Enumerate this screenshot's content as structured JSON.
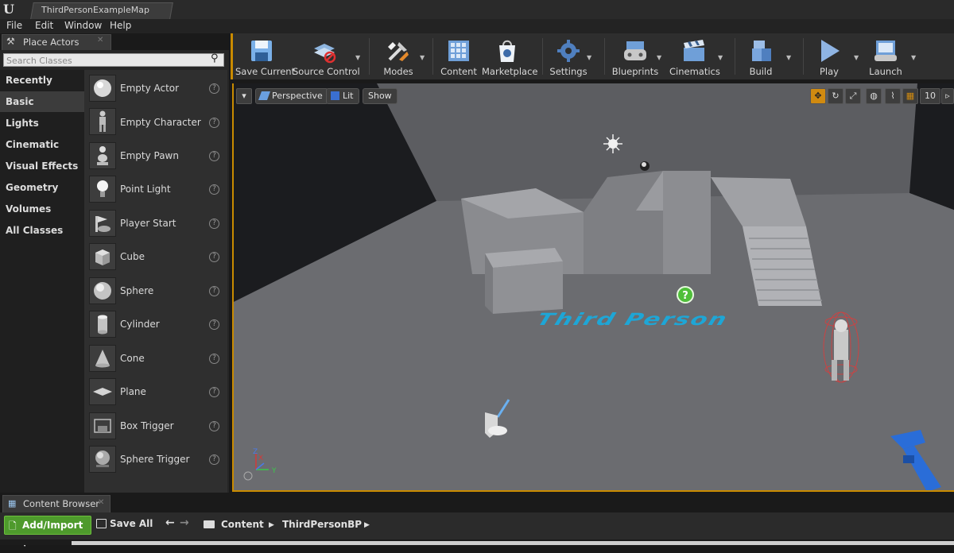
{
  "window": {
    "tab_title": "ThirdPersonExampleMap"
  },
  "menu": [
    "File",
    "Edit",
    "Window",
    "Help"
  ],
  "place_actors": {
    "tab_label": "Place Actors",
    "search_placeholder": "Search Classes",
    "categories": [
      "Recently Placed",
      "Basic",
      "Lights",
      "Cinematic",
      "Visual Effects",
      "Geometry",
      "Volumes",
      "All Classes"
    ],
    "active_category": "Basic",
    "actors": [
      "Empty Actor",
      "Empty Character",
      "Empty Pawn",
      "Point Light",
      "Player Start",
      "Cube",
      "Sphere",
      "Cylinder",
      "Cone",
      "Plane",
      "Box Trigger",
      "Sphere Trigger"
    ],
    "help_glyph": "?"
  },
  "toolbar": {
    "buttons": [
      "Save Current",
      "Source Control",
      "Modes",
      "Content",
      "Marketplace",
      "Settings",
      "Blueprints",
      "Cinematics",
      "Build",
      "Play",
      "Launch"
    ]
  },
  "viewport": {
    "perspective_label": "Perspective",
    "lit_label": "Lit",
    "show_label": "Show",
    "grid_snap_value": "10",
    "floor_text": "Third Person",
    "axis_z": "Z",
    "axis_x": "X",
    "axis_y": "Y"
  },
  "content_browser": {
    "tab_label": "Content Browser",
    "add_import_label": "Add/Import",
    "save_all_label": "Save All",
    "breadcrumb": [
      "Content",
      "ThirdPersonBP"
    ]
  },
  "colors": {
    "accent": "#c98b00",
    "add_import_green": "#4e9a2c",
    "floor_text": "#1ea6d6"
  }
}
